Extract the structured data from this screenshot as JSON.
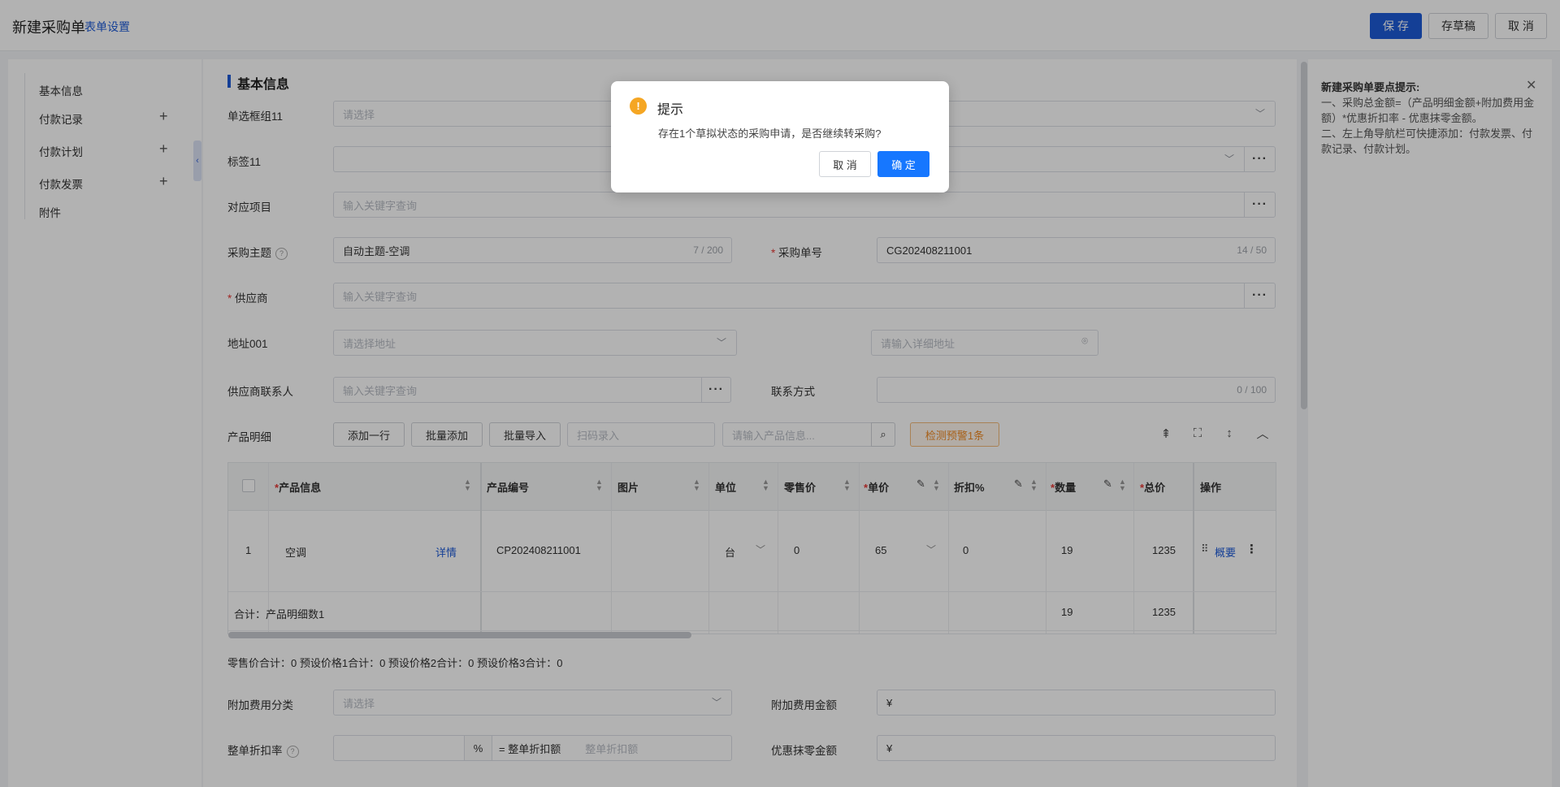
{
  "header": {
    "title": "新建采购单",
    "form_settings": "表单设置",
    "save": "保 存",
    "draft": "存草稿",
    "cancel": "取 消"
  },
  "sidebar": {
    "items": [
      {
        "label": "基本信息"
      },
      {
        "label": "付款记录"
      },
      {
        "label": "付款计划"
      },
      {
        "label": "付款发票"
      },
      {
        "label": "附件"
      }
    ],
    "plus": "+",
    "collapse": "‹"
  },
  "tips": {
    "title": "新建采购单要点提示:",
    "line1": "一、采购总金额=（产品明细金额+附加费用金额）*优惠折扣率 - 优惠抹零金额。",
    "line2": "二、左上角导航栏可快捷添加：付款发票、付款记录、付款计划。",
    "close": "✕"
  },
  "form": {
    "section_title": "基本信息",
    "radio_group": {
      "label": "单选框组11",
      "placeholder": "请选择"
    },
    "tag": {
      "label": "标签11"
    },
    "project": {
      "label": "对应项目",
      "placeholder": "输入关键字查询"
    },
    "subject": {
      "label": "采购主题",
      "value": "自动主题-空调",
      "counter": "7 / 200"
    },
    "order_no": {
      "label": "采购单号",
      "value": "CG202408211001",
      "counter": "14 / 50"
    },
    "supplier": {
      "label": "供应商",
      "placeholder": "输入关键字查询"
    },
    "address": {
      "label": "地址001",
      "placeholder": "请选择地址",
      "detail_placeholder": "请输入详细地址"
    },
    "contact": {
      "label": "供应商联系人",
      "placeholder": "输入关键字查询"
    },
    "contact_way": {
      "label": "联系方式",
      "counter": "0 / 100"
    },
    "more": "···",
    "required": "*",
    "help": "?"
  },
  "products": {
    "label": "产品明细",
    "add_row": "添加一行",
    "batch_add": "批量添加",
    "batch_import": "批量导入",
    "scan_placeholder": "扫码录入",
    "search_placeholder": "请输入产品信息...",
    "warn": "检测预警1条",
    "columns": {
      "product": "产品信息",
      "code": "产品编号",
      "image": "图片",
      "unit": "单位",
      "retail": "零售价",
      "price": "单价",
      "discount": "折扣%",
      "qty": "数量",
      "total": "总价",
      "ops": "操作"
    },
    "row": {
      "index": "1",
      "product": "空调",
      "detail": "详情",
      "code": "CP202408211001",
      "unit": "台",
      "retail": "0",
      "price": "65",
      "discount": "0",
      "qty": "19",
      "total": "1235",
      "summary_link": "概要"
    },
    "footer": {
      "label": "合计：产品明细数1",
      "qty": "19",
      "total": "1235"
    },
    "summary": "零售价合计：0 预设价格1合计：0 预设价格2合计：0 预设价格3合计：0"
  },
  "extra": {
    "fee_type": {
      "label": "附加费用分类",
      "placeholder": "请选择"
    },
    "fee_amount": {
      "label": "附加费用金额",
      "prefix": "¥"
    },
    "discount_rate": {
      "label": "整单折扣率",
      "unit": "%",
      "equals": "= 整单折扣额",
      "placeholder": "整单折扣额"
    },
    "round_off": {
      "label": "优惠抹零金额",
      "prefix": "¥"
    }
  },
  "dialog": {
    "icon": "!",
    "title": "提示",
    "message": "存在1个草拟状态的采购申请，是否继续转采购?",
    "cancel": "取 消",
    "confirm": "确 定"
  },
  "colors": {
    "primary": "#1e5bd7",
    "confirm": "#1677ff",
    "warning": "#f5a623",
    "required": "#e53935"
  }
}
